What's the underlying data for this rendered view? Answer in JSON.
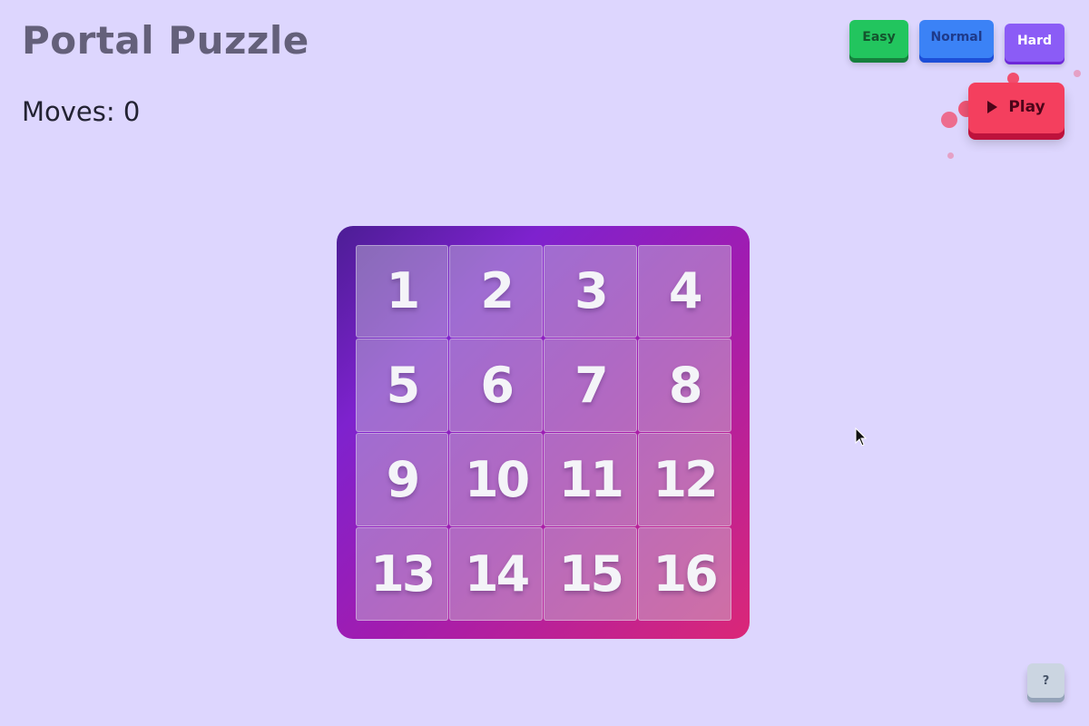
{
  "title": "Portal Puzzle",
  "moves_label": "Moves: 0",
  "moves": 0,
  "difficulty": {
    "easy": "Easy",
    "normal": "Normal",
    "hard": "Hard"
  },
  "play_label": "Play",
  "help_label": "?",
  "tiles": [
    "1",
    "2",
    "3",
    "4",
    "5",
    "6",
    "7",
    "8",
    "9",
    "10",
    "11",
    "12",
    "13",
    "14",
    "15",
    "16"
  ],
  "colors": {
    "background": "#ddd6fe",
    "easy": "#22c55e",
    "normal": "#3b82f6",
    "hard": "#8b5cf6",
    "play": "#f43f5e",
    "help": "#cbd5e1"
  },
  "icons": {
    "play": "play-triangle-icon",
    "cursor": "mouse-pointer-icon"
  }
}
